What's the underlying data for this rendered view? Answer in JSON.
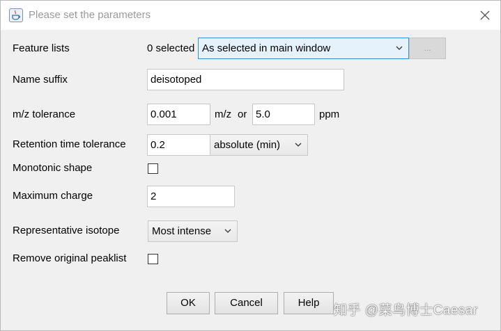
{
  "window": {
    "title": "Please set the parameters",
    "close_icon": "close-icon",
    "app_icon": "java-cup-icon"
  },
  "form": {
    "feature_lists": {
      "label": "Feature lists",
      "selected_count": "0 selected",
      "selection": "As selected in main window",
      "more_button": "..."
    },
    "name_suffix": {
      "label": "Name suffix",
      "value": "deisotoped"
    },
    "mz_tolerance": {
      "label": "m/z tolerance",
      "mz_value": "0.001",
      "mz_unit": "m/z",
      "or_text": "or",
      "ppm_value": "5.0",
      "ppm_unit": "ppm"
    },
    "rt_tolerance": {
      "label": "Retention time tolerance",
      "value": "0.2",
      "mode": "absolute (min)"
    },
    "monotonic_shape": {
      "label": "Monotonic shape",
      "checked": false
    },
    "maximum_charge": {
      "label": "Maximum charge",
      "value": "2"
    },
    "representative_isotope": {
      "label": "Representative isotope",
      "value": "Most intense"
    },
    "remove_original": {
      "label": "Remove original peaklist",
      "checked": false
    }
  },
  "buttons": {
    "ok": "OK",
    "cancel": "Cancel",
    "help": "Help"
  },
  "watermark": "知乎 @菜鸟博士Caesar",
  "colors": {
    "accent_border": "#3c8fd6",
    "accent_fill": "#e5f1fb",
    "dialog_bg": "#f0f0f0"
  }
}
